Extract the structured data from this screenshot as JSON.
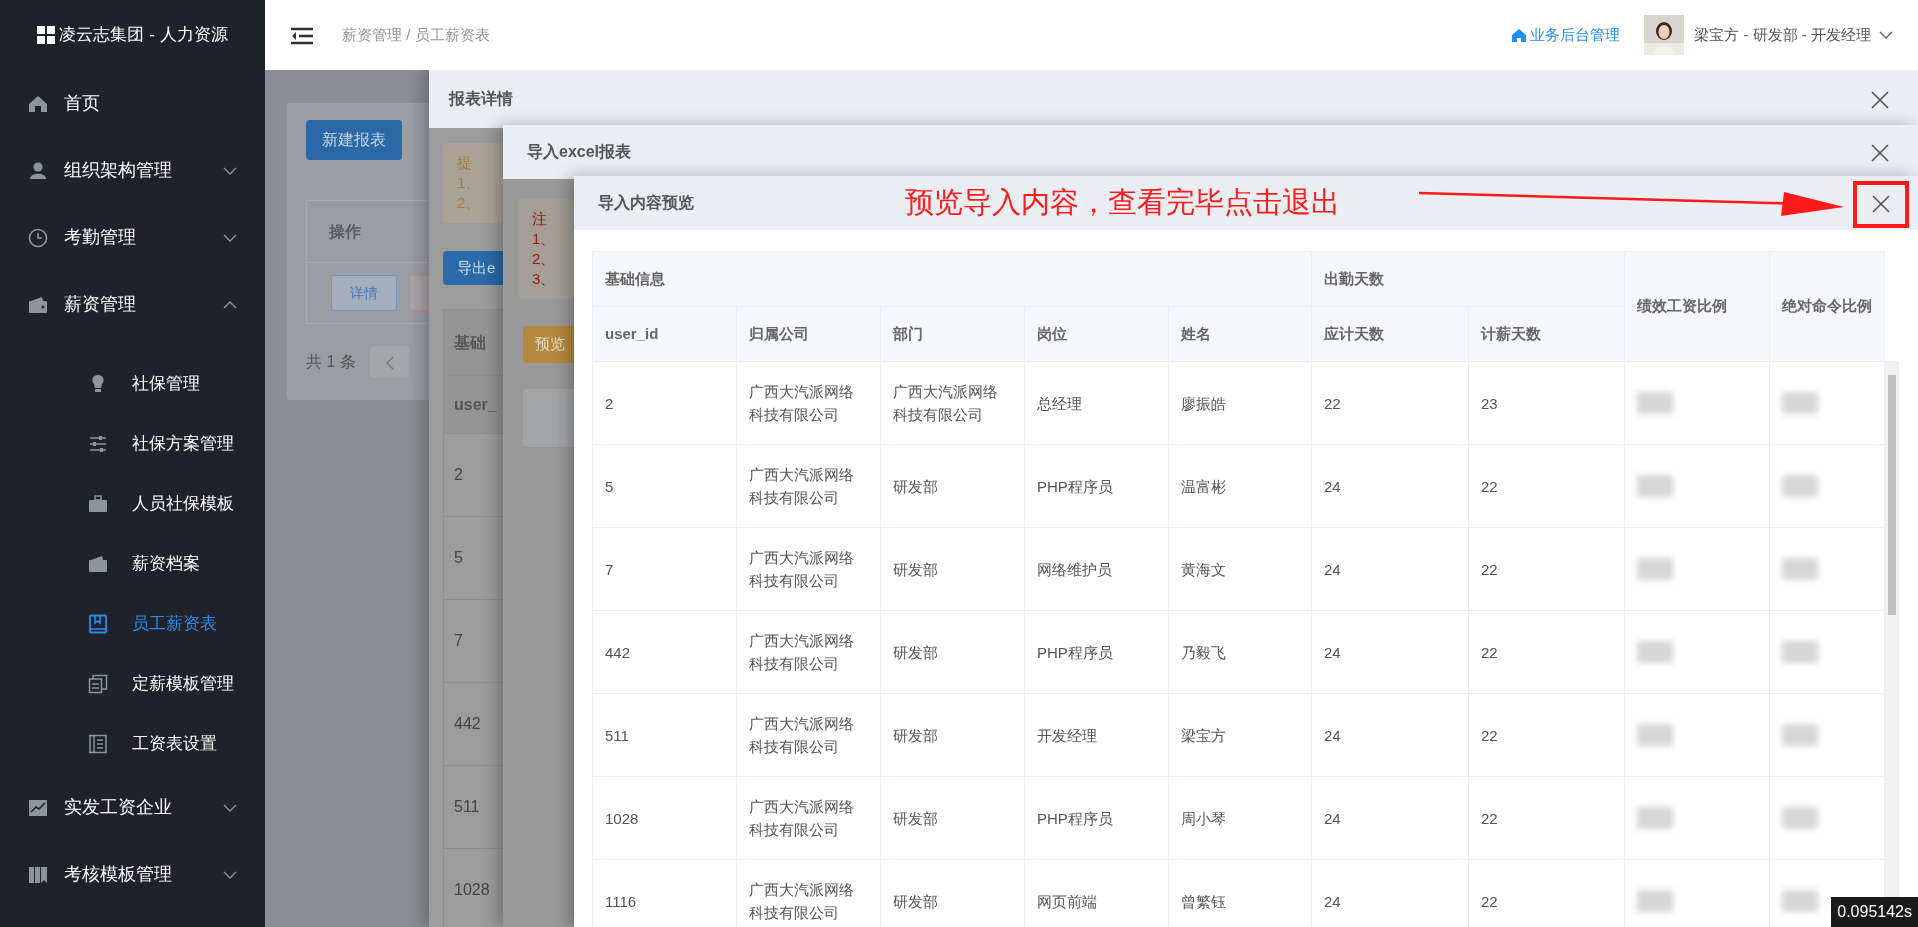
{
  "sidebar": {
    "logo": "凌云志集团 - 人力资源",
    "items": [
      {
        "label": "首页",
        "kind": "link"
      },
      {
        "label": "组织架构管理",
        "kind": "menu",
        "expanded": false
      },
      {
        "label": "考勤管理",
        "kind": "menu",
        "expanded": false
      },
      {
        "label": "薪资管理",
        "kind": "menu",
        "expanded": true,
        "children": [
          {
            "label": "社保管理",
            "selected": false
          },
          {
            "label": "社保方案管理",
            "selected": false
          },
          {
            "label": "人员社保模板",
            "selected": false
          },
          {
            "label": "薪资档案",
            "selected": false
          },
          {
            "label": "员工薪资表",
            "selected": true
          },
          {
            "label": "定薪模板管理",
            "selected": false
          },
          {
            "label": "工资表设置",
            "selected": false
          }
        ]
      },
      {
        "label": "实发工资企业",
        "kind": "menu",
        "expanded": false
      },
      {
        "label": "考核模板管理",
        "kind": "menu",
        "expanded": false
      }
    ]
  },
  "header": {
    "breadcrumb": "薪资管理 / 员工薪资表",
    "admin_link": "业务后台管理",
    "user": "梁宝方 - 研发部 - 开发经理"
  },
  "page": {
    "new_button": "新建报表",
    "table": {
      "columns": [
        "操作"
      ],
      "row_buttons": [
        "详情"
      ]
    },
    "total": "共 1 条"
  },
  "report_dialog": {
    "title": "报表详情",
    "notice": {
      "title": "提",
      "lines": [
        "1、",
        "2、"
      ]
    },
    "export_button": "导出e",
    "table": {
      "group_header": "基础",
      "columns": [
        "user_"
      ],
      "rows": [
        "2",
        "5",
        "7",
        "442",
        "511",
        "1028"
      ]
    }
  },
  "import_dialog": {
    "title": "导入excel报表",
    "notice": {
      "title": "注",
      "lines": [
        "1、",
        "2、",
        "3、"
      ]
    },
    "preview_button": "预览"
  },
  "preview_dialog": {
    "title": "导入内容预览",
    "table": {
      "groups": [
        {
          "label": "基础信息",
          "columns": [
            "user_id",
            "归属公司",
            "部门",
            "岗位",
            "姓名"
          ]
        },
        {
          "label": "出勤天数",
          "columns": [
            "应计天数",
            "计薪天数"
          ]
        },
        {
          "label": "绩效工资比例"
        },
        {
          "label": "绝对命令比例"
        }
      ],
      "rows": [
        [
          "2",
          "广西大汽派网络科技有限公司",
          "广西大汽派网络科技有限公司",
          "总经理",
          "廖振皓",
          "22",
          "23"
        ],
        [
          "5",
          "广西大汽派网络科技有限公司",
          "研发部",
          "PHP程序员",
          "温富彬",
          "24",
          "22"
        ],
        [
          "7",
          "广西大汽派网络科技有限公司",
          "研发部",
          "网络维护员",
          "黄海文",
          "24",
          "22"
        ],
        [
          "442",
          "广西大汽派网络科技有限公司",
          "研发部",
          "PHP程序员",
          "乃毅飞",
          "24",
          "22"
        ],
        [
          "511",
          "广西大汽派网络科技有限公司",
          "研发部",
          "开发经理",
          "梁宝方",
          "24",
          "22"
        ],
        [
          "1028",
          "广西大汽派网络科技有限公司",
          "研发部",
          "PHP程序员",
          "周小琴",
          "24",
          "22"
        ],
        [
          "1116",
          "广西大汽派网络科技有限公司",
          "研发部",
          "网页前端",
          "曾繁钰",
          "24",
          "22"
        ]
      ]
    }
  },
  "annotation": {
    "text": "预览导入内容，查看完毕点击退出"
  },
  "timer": "0.095142s"
}
